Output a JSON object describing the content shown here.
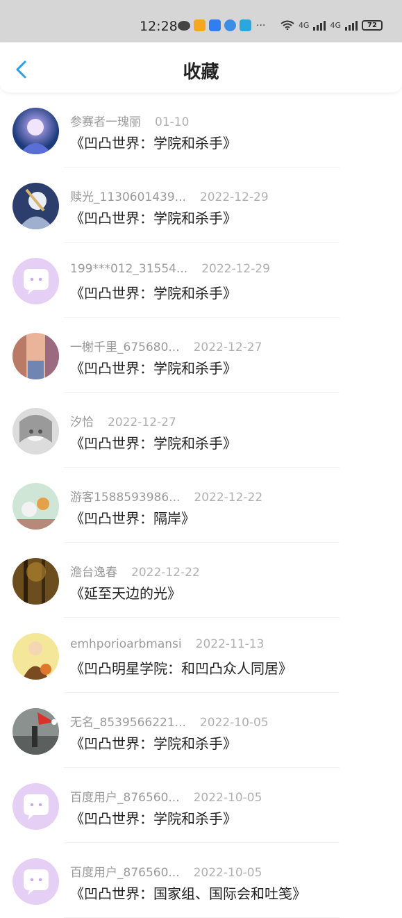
{
  "status": {
    "time": "12:28",
    "battery": "72",
    "net1": "4G",
    "net2": "4G"
  },
  "header": {
    "title": "收藏"
  },
  "items": [
    {
      "user": "参赛者一瑰丽",
      "date": "01-10",
      "title": "《凹凸世界：学院和杀手》",
      "avatar": "anime-girl-blue"
    },
    {
      "user": "赎光_1130601439...",
      "date": "2022-12-29",
      "title": "《凹凸世界：学院和杀手》",
      "avatar": "anime-char-light"
    },
    {
      "user": "199***012_31554...",
      "date": "2022-12-29",
      "title": "《凹凸世界：学院和杀手》",
      "avatar": "default-chat"
    },
    {
      "user": "一榭千里_675680...",
      "date": "2022-12-27",
      "title": "《凹凸世界：学院和杀手》",
      "avatar": "city-street"
    },
    {
      "user": "汐恰",
      "date": "2022-12-27",
      "title": "《凹凸世界：学院和杀手》",
      "avatar": "grey-anime"
    },
    {
      "user": "游客1588593986...",
      "date": "2022-12-22",
      "title": "《凹凸世界：隔岸》",
      "avatar": "cartoon-animals"
    },
    {
      "user": "澹台逸春",
      "date": "2022-12-22",
      "title": "《延至天边的光》",
      "avatar": "forest-dark"
    },
    {
      "user": "emhporioarbmansi",
      "date": "2022-11-13",
      "title": "《凹凸明星学院：和凹凸众人同居》",
      "avatar": "yellow-boy"
    },
    {
      "user": "无名_8539566221...",
      "date": "2022-10-05",
      "title": "《凹凸世界：学院和杀手》",
      "avatar": "santa-hat"
    },
    {
      "user": "百度用户_876560...",
      "date": "2022-10-05",
      "title": "《凹凸世界：学院和杀手》",
      "avatar": "default-chat"
    },
    {
      "user": "百度用户_876560...",
      "date": "2022-10-05",
      "title": "《凹凸世界：国家组、国际会和吐笺》",
      "avatar": "default-chat"
    }
  ]
}
